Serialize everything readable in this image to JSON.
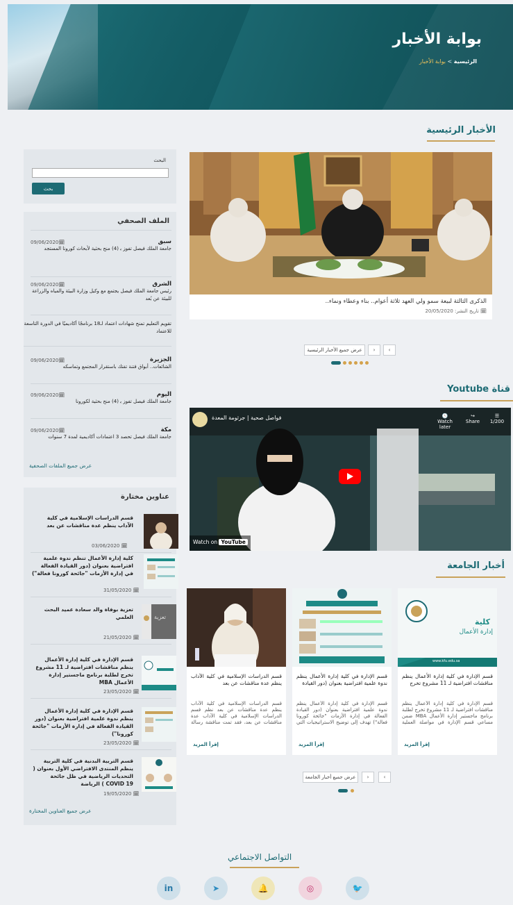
{
  "hero": {
    "title": "بوابة الأخبار",
    "breadcrumb_home": "الرئيسية",
    "breadcrumb_sep": ">",
    "breadcrumb_current": "بوابة الأخبار"
  },
  "main_news": {
    "title": "الأخبار الرئيسية",
    "caption": "الذكرى الثالثة لبيعة سمو ولي العهد ثلاثة أعوام.. بناء وعطاء ونماء..",
    "date_label": "تاريخ النشر",
    "date": "20/05/2020",
    "all_label": "عرض جميع الأخبار الرئيسية"
  },
  "search": {
    "label": "البحث",
    "button": "بحث"
  },
  "press": {
    "title": "الملف الصحفي",
    "items": [
      {
        "source": "سبق",
        "date": "09/06/2020",
        "text": "جامعة الملك فيصل تفوز ﺑ (4) منح بحثية لأبحاث كورونا المستجد"
      },
      {
        "source": "الشرق",
        "date": "09/06/2020",
        "text": "رئيس جامعة الملك فيصل يجتمع مع وكيل وزارة البيئة والمياه والزراعة للبيئة عن بُعد"
      },
      {
        "source": "",
        "date": "",
        "text": "تقويم التعليم تمنح شهادات اعتماد لـ18 برنامجًا أكاديميًا في الدورة التاسعة للاعتماد"
      },
      {
        "source": "الجزيرة",
        "date": "09/06/2020",
        "text": "الشائعات.. أبواق فتنة تفتك باستقرار المجتمع وتماسكه"
      },
      {
        "source": "اليوم",
        "date": "09/06/2020",
        "text": "جامعة الملك فيصل تفوز ﺑ (4) منح بحثية لكورونا"
      },
      {
        "source": "مكة",
        "date": "09/06/2020",
        "text": "جامعة الملك فيصل تحصد 3 اعتمادات أكاديمية لمدة 7 سنوات"
      }
    ],
    "all_label": "عرض جميع الملفات الصحفية"
  },
  "youtube": {
    "title": "قناة Youtube",
    "video_title": "فواصل صحية | جرثومة المعدة",
    "watch_later": "Watch later",
    "share": "Share",
    "count": "1/200",
    "watch_on": "Watch on",
    "yt": "YouTube"
  },
  "uni_news": {
    "title": "أخبار الجامعة",
    "more": "إقرأ المزيد",
    "all_label": "عرض جميع أخبار الجامعة",
    "cards": [
      {
        "heading": "قسم الإدارة في كلية إدارة الأعمال ينظم مناقشات افتراضية لـ 11 مشروع تخرج",
        "text": "قسم الإدارة في كلية إدارة الأعمال ينظم مناقشات افتراضية لـ 11 مشروع تخرج لطلبة برنامج ماجستير إدارة الأعمال MBA ضمن مساعي قسم الإدارة في مواصلة العملية التعليمية",
        "img_college": "كلية",
        "img_dept": "إدارة الأعمال",
        "img_url": "www.kfu.edu.sa"
      },
      {
        "heading": "قسم الإدارة في كلية إدارة الأعمال ينظم ندوة علمية افتراضية بعنوان (دور القيادة",
        "text": "قسم الإدارة في كلية إدارة الأعمال ينظم ندوة علمية افتراضية بعنوان (دور القيادة الفعالة في إدارة الأزمات \"جائحة كورونا فعالة\") تهدف إلى توضيح الاستراتيجيات التي تواجهها إدارة المؤسسات"
      },
      {
        "heading": "قسم الدراسات الإسلامية في كلية الآداب ينظم عدة مناقشات عن بعد",
        "text": "قسم الدراسات الإسلامية في كلية الآداب ينظم عدة مناقشات عن بعد نظم قسم الدراسات الإسلامية في كلية الآداب عدة مناقشات عن بعد، فقد تمت مناقشة رسالة الطالب"
      }
    ]
  },
  "selected": {
    "title": "عناوين مختارة",
    "all_label": "عرض جميع العناوين المختارة",
    "items": [
      {
        "title": "قسم الدراسات الإسلامية في كلية الآداب ينظم عدة مناقشات عن بعد",
        "date": "03/06/2020"
      },
      {
        "title": "كلية إدارة الأعمال تنظم ندوة علمية افتراضية بعنوان (دور القيادة الفعالة في إدارة الأزمات \"جائحة كورونا فعالة\")",
        "date": "31/05/2020"
      },
      {
        "title": "تعزية بوفاة والد سعادة عميد البحث العلمي",
        "date": "21/05/2020",
        "thumb_text": "تعزية"
      },
      {
        "title": "قسم الإدارة في كلية إدارة الأعمال ينظم مناقشات افتراضية لـ 11 مشروع تخرج لطلبة برنامج ماجستير إدارة الأعمال MBA",
        "date": "23/05/2020"
      },
      {
        "title": "قسم الإدارة في كلية إدارة الأعمال ينظم ندوة علمية افتراضية بعنوان (دور القيادة الفعالة في إدارة الأزمات \"جائحة كورونا\")",
        "date": "23/05/2020"
      },
      {
        "title": "قسم التربية البدنية في كلية التربية ينظم المنتدى الافتراضي الأول بعنوان ( التحديات الرياضية في ظل جائحة COVID 19 ) الرياضة",
        "date": "19/05/2020"
      }
    ]
  },
  "social": {
    "title": "التواصل الاجتماعي",
    "items": [
      {
        "icon": "linkedin-icon",
        "glyph": "in",
        "bg": "#cfe0ea",
        "fg": "#2a7aa8"
      },
      {
        "icon": "telegram-icon",
        "glyph": "➤",
        "bg": "#cfe0ea",
        "fg": "#2f8cc0"
      },
      {
        "icon": "snapchat-icon",
        "glyph": "🔔",
        "bg": "#efe6b8",
        "fg": "#c9a400"
      },
      {
        "icon": "instagram-icon",
        "glyph": "◎",
        "bg": "#f1d4de",
        "fg": "#c0306a"
      },
      {
        "icon": "twitter-icon",
        "glyph": "🐦",
        "bg": "#cfe0ea",
        "fg": "#2f8cc0"
      }
    ]
  },
  "colors": {
    "brand": "#1d6b74",
    "accent": "#c9a25a"
  }
}
